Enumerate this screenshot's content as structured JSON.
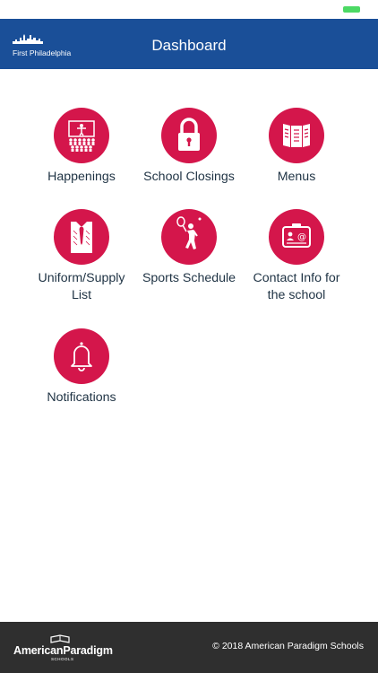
{
  "header": {
    "title": "Dashboard",
    "logo_text": "First Philadelphia"
  },
  "tiles": [
    {
      "label": "Happenings",
      "icon": "audience-icon"
    },
    {
      "label": "School Closings",
      "icon": "padlock-icon"
    },
    {
      "label": "Menus",
      "icon": "menu-booklet-icon"
    },
    {
      "label": "Uniform/Supply List",
      "icon": "shirt-tie-icon"
    },
    {
      "label": "Sports Schedule",
      "icon": "tennis-player-icon"
    },
    {
      "label": "Contact Info for the school",
      "icon": "contact-card-icon"
    },
    {
      "label": "Notifications",
      "icon": "bell-icon"
    }
  ],
  "footer": {
    "brand": "AmericanParadigm",
    "brand_sub": "SCHOOLS",
    "copyright": "© 2018 American Paradigm Schools"
  },
  "colors": {
    "header_bg": "#1a4f98",
    "tile_circle": "#d4164b",
    "footer_bg": "#2f2f2f",
    "label_text": "#1f3344"
  }
}
